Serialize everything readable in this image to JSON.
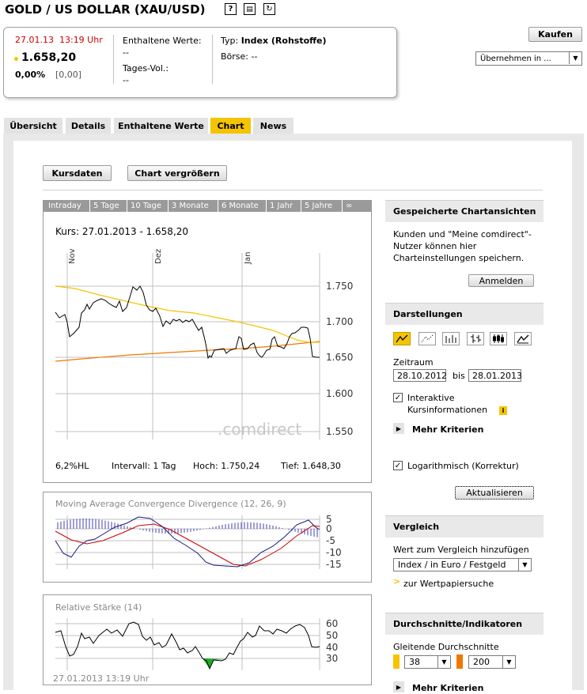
{
  "title": "GOLD / US DOLLAR (XAU/USD)",
  "header_icons": [
    "help-icon",
    "print-icon",
    "refresh-icon"
  ],
  "quote": {
    "date": "27.01.13",
    "time": "13:19 Uhr",
    "price": "1.658,20",
    "change_pct": "0,00%",
    "change_abs": "[0,00]",
    "contained_label": "Enthaltene Werte:",
    "contained_value": "--",
    "volume_label": "Tages-Vol.:",
    "volume_value": "--",
    "type_label": "Typ:",
    "type_value": "Index (Rohstoffe)",
    "exchange_label": "Börse:",
    "exchange_value": "--"
  },
  "actions": {
    "buy": "Kaufen",
    "take_over": "Übernehmen in ..."
  },
  "tabs": [
    "Übersicht",
    "Details",
    "Enthaltene Werte",
    "Chart",
    "News"
  ],
  "toolbar": {
    "kursdaten": "Kursdaten",
    "enlarge": "Chart vergrößern"
  },
  "timeframes": [
    "Intraday",
    "5 Tage",
    "10 Tage",
    "3 Monate",
    "6 Monate",
    "1 Jahr",
    "5 Jahre",
    "∞"
  ],
  "main_chart": {
    "caption": "Kurs: 27.01.2013 - 1.658,20",
    "months": [
      "Nov",
      "Dez",
      "Jan"
    ],
    "y_ticks": [
      "1.750",
      "1.700",
      "1.650",
      "1.600",
      "1.550"
    ],
    "watermark": ".comdirect",
    "stats": {
      "hl": "6,2%HL",
      "interval": "Intervall: 1 Tag",
      "high": "Hoch: 1.750,24",
      "low": "Tief: 1.648,30"
    }
  },
  "macd": {
    "title": "Moving Average Convergence Divergence (12, 26, 9)",
    "y_ticks": [
      "5",
      "0",
      "-5",
      "-10",
      "-15"
    ]
  },
  "rsi": {
    "title": "Relative Stärke (14)",
    "y_ticks": [
      "60",
      "50",
      "40",
      "30"
    ],
    "timestamp": "27.01.2013 13:19 Uhr"
  },
  "sidebar": {
    "saved_title": "Gespeicherte Chartansichten",
    "saved_text": "Kunden und \"Meine comdirect\"-Nutzer können hier Charteinstellungen speichern.",
    "login": "Anmelden",
    "views_title": "Darstellungen",
    "period_label": "Zeitraum",
    "date_from": "28.10.2012",
    "bis": "bis",
    "date_to": "28.01.2013",
    "interactive": "Interaktive Kursinformationen",
    "more_criteria": "Mehr Kriterien",
    "log_label": "Logarithmisch (Korrektur)",
    "update": "Aktualisieren",
    "compare_title": "Vergleich",
    "compare_label": "Wert zum Vergleich hinzufügen",
    "compare_select": "Index / in Euro / Festgeld",
    "to_search": "zur Wertpapiersuche",
    "indicators_title": "Durchschnitte/Indikatoren",
    "ma_label": "Gleitende Durchschnitte",
    "ma1": "38",
    "ma2": "200",
    "more_criteria2": "Mehr Kriterien"
  },
  "colors": {
    "accent": "#f5c400",
    "ma1": "#f5c400",
    "ma2": "#f07800",
    "red": "#cc0000"
  }
}
